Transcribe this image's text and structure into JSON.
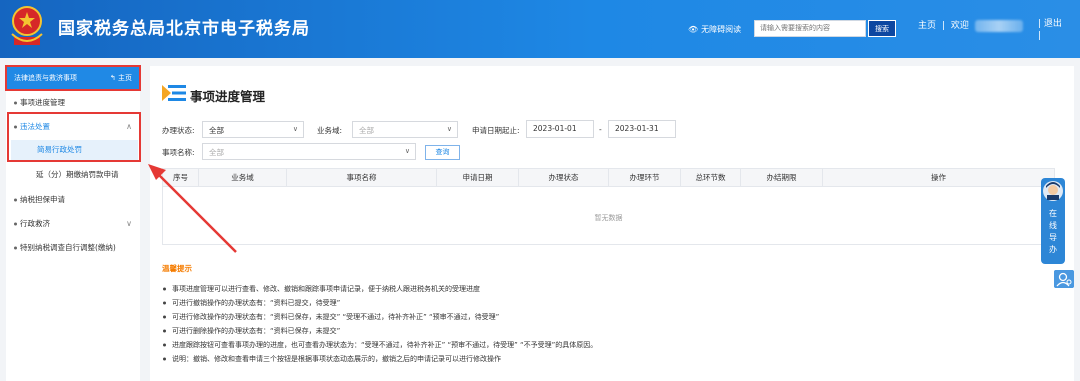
{
  "header": {
    "title": "国家税务总局北京市电子税务局",
    "accessibility": "无障碍阅读",
    "search_placeholder": "请输入需要搜索的内容",
    "search_button": "搜索",
    "home_link": "主页",
    "welcome": "欢迎",
    "exit": "退出"
  },
  "sidebar": {
    "head_title": "法律追责与救济事项",
    "head_home": "主页",
    "items": [
      {
        "label": "事项进度管理"
      },
      {
        "label": "违法处置"
      },
      {
        "label": "简易行政处罚"
      },
      {
        "label": "延（分）期缴纳罚款申请"
      },
      {
        "label": "纳税担保申请"
      },
      {
        "label": "行政救济"
      },
      {
        "label": "特别纳税调查自行调整(缴纳)"
      }
    ]
  },
  "main": {
    "page_title": "事项进度管理",
    "filters": {
      "status_label": "办理状态:",
      "status_value": "全部",
      "domain_label": "业务域:",
      "domain_value": "全部",
      "date_label": "申请日期起止:",
      "date_from": "2023-01-01",
      "date_sep": "-",
      "date_to": "2023-01-31",
      "name_label": "事项名称:",
      "name_value": "全部",
      "query_button": "查询"
    },
    "table": {
      "columns": [
        "序号",
        "业务域",
        "事项名称",
        "申请日期",
        "办理状态",
        "办理环节",
        "总环节数",
        "办结期限",
        "操作"
      ],
      "empty_text": "暂无数据"
    },
    "tips": {
      "title": "温馨提示",
      "lines": [
        "事项进度管理可以进行查看、修改、撤销和跟踪事项申请记录，便于纳税人跟进税务机关的受理进度",
        "可进行撤销操作的办理状态有：“资料已提交，待受理”",
        "可进行修改操作的办理状态有：“资料已保存，未提交” “受理不通过，待补齐补正” “预审不通过，待受理”",
        "可进行删除操作的办理状态有：“资料已保存，未提交”",
        "进度跟踪按钮可查看事项办理的进度，也可查看办理状态为：“受理不通过，待补齐补正” “预审不通过，待受理” “不予受理”的具体原因。",
        "说明：撤销、修改和查看申请三个按钮是根据事项状态动态展示的，撤销之后的申请记录可以进行修改操作"
      ]
    }
  },
  "float_guide": {
    "label": "在线导办"
  },
  "colors": {
    "header_blue": "#1e88e5",
    "accent_blue": "#1e88e5",
    "highlight_red": "#e53935",
    "tip_orange": "#f57c00"
  }
}
